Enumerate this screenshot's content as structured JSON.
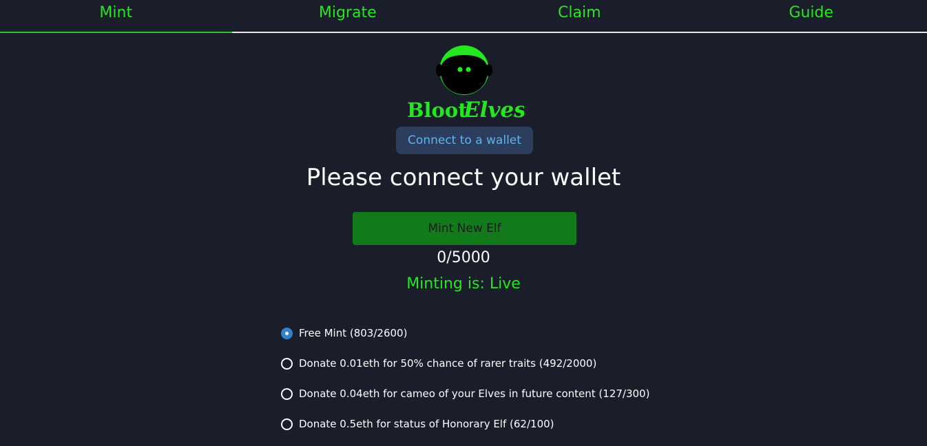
{
  "nav": {
    "tabs": [
      {
        "label": "Mint",
        "active": true
      },
      {
        "label": "Migrate",
        "active": false
      },
      {
        "label": "Claim",
        "active": false
      },
      {
        "label": "Guide",
        "active": false
      }
    ]
  },
  "logo": {
    "text_part1": "Bloot",
    "text_part2": "Elves"
  },
  "wallet": {
    "connect_label": "Connect to a wallet"
  },
  "main": {
    "heading": "Please connect your wallet",
    "mint_button_label": "Mint New Elf",
    "count": "0/5000",
    "status": "Minting is: Live"
  },
  "options": [
    {
      "label": "Free Mint (803/2600)",
      "selected": true
    },
    {
      "label": "Donate 0.01eth for 50% chance of rarer traits (492/2000)",
      "selected": false
    },
    {
      "label": "Donate 0.04eth for cameo of your Elves in future content (127/300)",
      "selected": false
    },
    {
      "label": "Donate 0.5eth for status of Honorary Elf (62/100)",
      "selected": false
    }
  ],
  "colors": {
    "background": "#1a1e2b",
    "accent_green": "#23e81f",
    "mint_button": "#127a1b",
    "connect_button_bg": "#2c3d5e",
    "connect_button_text": "#63b3ed",
    "radio_selected": "#3182ce"
  }
}
